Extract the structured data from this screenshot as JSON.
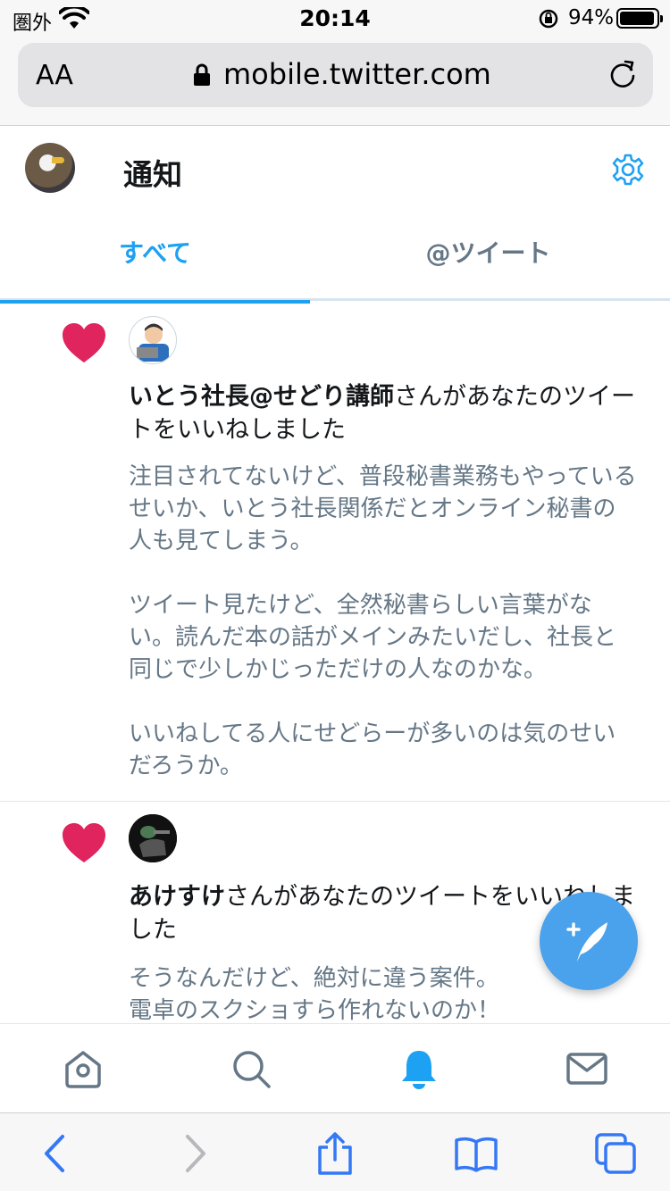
{
  "status_bar": {
    "carrier": "圏外",
    "time": "20:14",
    "battery_percent": "94%"
  },
  "browser": {
    "text_size_label": "AA",
    "url": "mobile.twitter.com"
  },
  "header": {
    "title": "通知"
  },
  "tabs": [
    {
      "label": "すべて",
      "active": true
    },
    {
      "label": "@ツイート",
      "active": false
    }
  ],
  "notifications": [
    {
      "type": "like",
      "user_name": "いとう社長@せどり講師",
      "action_text": "さんがあなたのツイートをいいねしました",
      "tweet_paragraphs": [
        "注目されてないけど、普段秘書業務もやっているせいか、いとう社長関係だとオンライン秘書の人も見てしまう。",
        "ツイート見たけど、全然秘書らしい言葉がない。読んだ本の話がメインみたいだし、社長と同じで少しかじっただけの人なのかな。",
        "いいねしてる人にせどらーが多いのは気のせいだろうか。"
      ]
    },
    {
      "type": "like",
      "user_name": "あけすけ",
      "action_text": "さんがあなたのツイートをいいねしました",
      "tweet_paragraphs": [
        "そうなんだけど、絶対に違う案件。",
        "電卓のスクショすら作れないのか！"
      ]
    }
  ],
  "colors": {
    "accent": "#1da1f2",
    "fab": "#4aa1ec",
    "heart": "#e0245e",
    "secondary_text": "#657786",
    "safari_tint": "#3478f6"
  },
  "icons": {
    "bottom_nav": [
      "home-icon",
      "search-icon",
      "bell-icon",
      "mail-icon"
    ],
    "safari_toolbar": [
      "back-icon",
      "forward-icon",
      "share-icon",
      "bookmarks-icon",
      "tabs-icon"
    ]
  }
}
